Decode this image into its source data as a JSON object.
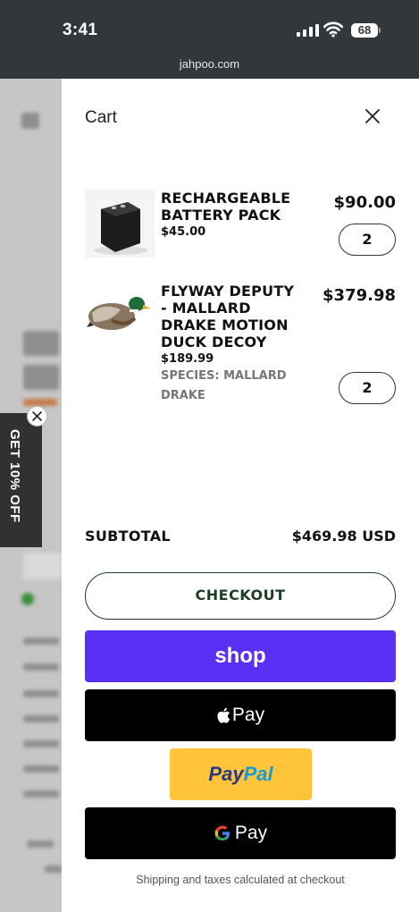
{
  "status_bar": {
    "time": "3:41",
    "battery": "68"
  },
  "browser": {
    "url": "jahpoo.com"
  },
  "promo": {
    "label": "GET 10% OFF"
  },
  "cart": {
    "title": "Cart",
    "items": [
      {
        "name": "RECHARGEABLE BATTERY PACK",
        "unit_price": "$45.00",
        "total": "$90.00",
        "quantity": "2"
      },
      {
        "name": "FLYWAY DEPUTY - MALLARD DRAKE MOTION DUCK DECOY",
        "unit_price": "$189.99",
        "variant": "SPECIES: MALLARD DRAKE",
        "total": "$379.98",
        "quantity": "2"
      }
    ],
    "subtotal_label": "SUBTOTAL",
    "subtotal_value": "$469.98 USD",
    "checkout_label": "CHECKOUT",
    "shop_pay_label": "shop",
    "apple_pay_label": "Pay",
    "paypal": {
      "part1": "Pay",
      "part2": "Pal"
    },
    "gpay_label": "Pay",
    "shipping_note": "Shipping and taxes calculated at checkout"
  },
  "colors": {
    "checkout_green": "#1e3d26",
    "shop_pay_purple": "#5a31f4",
    "paypal_yellow": "#ffc439"
  }
}
